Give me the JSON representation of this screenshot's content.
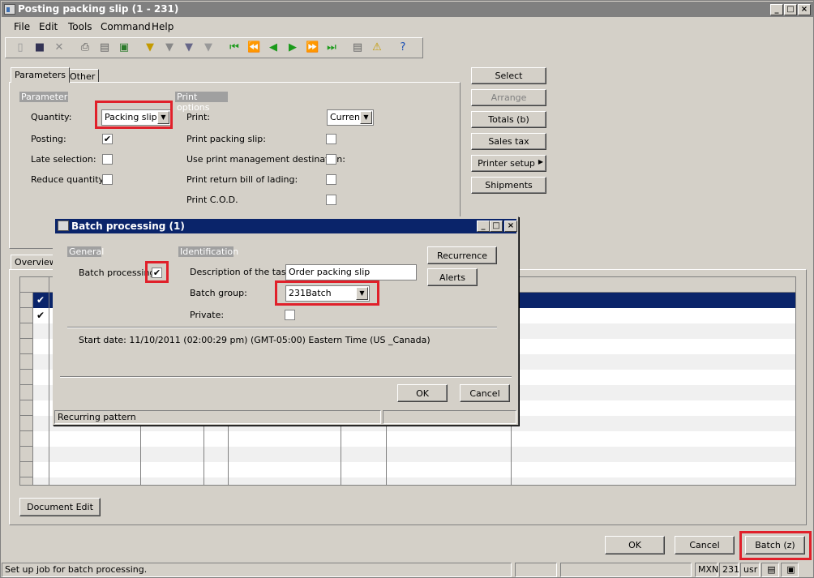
{
  "window": {
    "title": "Posting packing slip (1 - 231)"
  },
  "menu": [
    "File",
    "Edit",
    "Tools",
    "Command",
    "Help"
  ],
  "tabs": {
    "parameters": "Parameters",
    "other": "Other"
  },
  "parameter": {
    "header": "Parameter",
    "quantity_label": "Quantity:",
    "quantity_value": "Packing slip",
    "posting_label": "Posting:",
    "late_label": "Late selection:",
    "reduce_label": "Reduce quantity:"
  },
  "print_options": {
    "header": "Print options",
    "print_label": "Print:",
    "print_value": "Current",
    "packing_slip_label": "Print packing slip:",
    "print_mgmt_label": "Use print management destination:",
    "return_label": "Print return bill of lading:",
    "cod_label": "Print C.O.D."
  },
  "side_buttons": {
    "select": "Select",
    "arrange": "Arrange",
    "totals": "Totals (b)",
    "sales_tax": "Sales tax",
    "printer_setup": "Printer setup",
    "shipments": "Shipments"
  },
  "overview": {
    "label": "Overview"
  },
  "document_edit": "Document Edit",
  "bottom_buttons": {
    "ok": "OK",
    "cancel": "Cancel",
    "batch": "Batch (z)"
  },
  "statusbar": {
    "message": "Set up job for batch processing.",
    "currency": "MXN",
    "company": "231",
    "user": "usr"
  },
  "dialog": {
    "title": "Batch processing (1)",
    "general_header": "General",
    "identification_header": "Identification",
    "batch_processing_label": "Batch processing",
    "description_label": "Description of the task:",
    "description_value": "Order packing slip",
    "batch_group_label": "Batch group:",
    "batch_group_value": "231Batch",
    "private_label": "Private:",
    "start_date": "Start date: 11/10/2011 (02:00:29 pm) (GMT-05:00) Eastern Time (US _Canada)",
    "recurrence_button": "Recurrence",
    "alerts_button": "Alerts",
    "ok_button": "OK",
    "cancel_button": "Cancel",
    "status_text": "Recurring pattern"
  }
}
